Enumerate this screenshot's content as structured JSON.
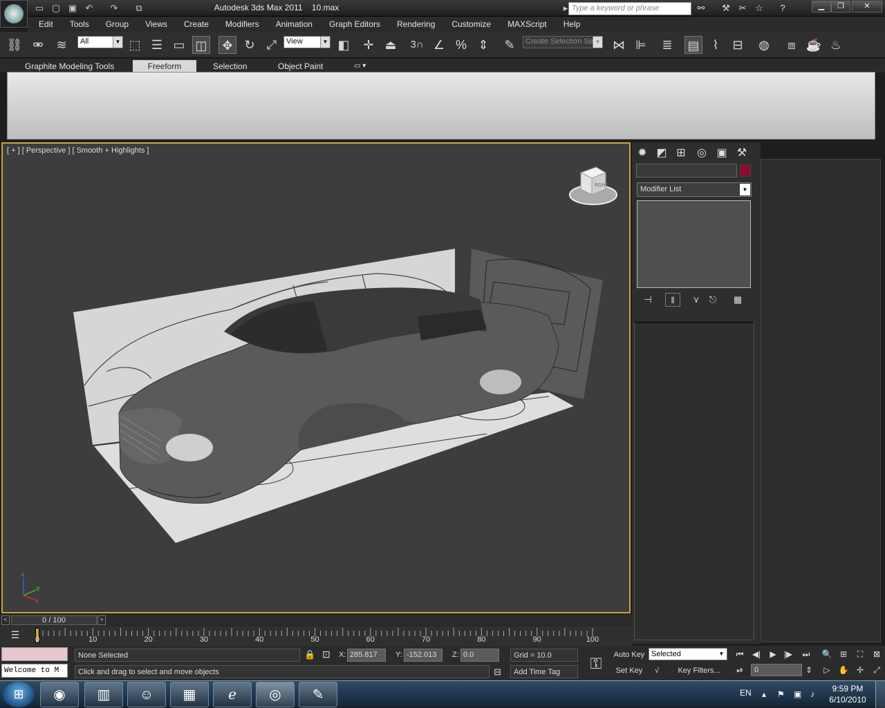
{
  "window": {
    "title": "Autodesk 3ds Max 2011",
    "file": "10.max",
    "search_placeholder": "Type a keyword or phrase"
  },
  "menu": [
    "Edit",
    "Tools",
    "Group",
    "Views",
    "Create",
    "Modifiers",
    "Animation",
    "Graph Editors",
    "Rendering",
    "Customize",
    "MAXScript",
    "Help"
  ],
  "toolbar": {
    "selection_filter": "All",
    "reference_coord": "View",
    "named_selection_placeholder": "Create Selection Se",
    "snap_label": "3"
  },
  "ribbon": {
    "tabs": [
      "Graphite Modeling Tools",
      "Freeform",
      "Selection",
      "Object Paint"
    ],
    "active_tab": "Freeform"
  },
  "viewport": {
    "label": "[ + ] [ Perspective ] [ Smooth + Highlights ]",
    "viewcube_label": "RGHT",
    "axis": {
      "x": "x",
      "y": "y",
      "z": "z"
    }
  },
  "command_panel": {
    "modifier_list": "Modifier List",
    "object_color": "#8c0b30"
  },
  "timeline": {
    "position": "0 / 100",
    "ticks": [
      "0",
      "10",
      "20",
      "30",
      "40",
      "50",
      "60",
      "70",
      "80",
      "90",
      "100"
    ]
  },
  "status": {
    "selection": "None Selected",
    "prompt": "Click and drag to select and move objects",
    "listener": "Welcome to M",
    "x_label": "X:",
    "x": "285.817",
    "y_label": "Y:",
    "y": "-152.013",
    "z_label": "Z:",
    "z": "0.0",
    "grid": "Grid = 10.0",
    "add_time_tag": "Add Time Tag",
    "auto_key": "Auto Key",
    "set_key": "Set Key",
    "key_mode": "Selected",
    "key_filters": "Key Filters...",
    "frame": "0"
  },
  "taskbar": {
    "lang": "EN",
    "time": "9:59 PM",
    "date": "6/10/2010"
  }
}
